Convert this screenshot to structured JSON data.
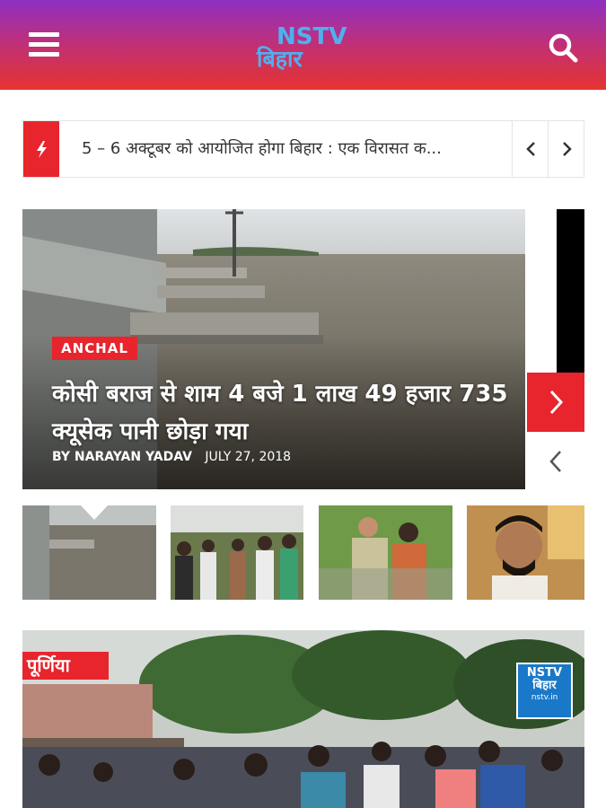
{
  "header": {
    "logo_line1": "NSTV",
    "logo_line2": "बिहार",
    "menu_icon": "hamburger-menu-icon",
    "search_icon": "search-icon",
    "gradient_colors": [
      "#8e2fc2",
      "#e6342f"
    ]
  },
  "ticker": {
    "icon": "lightning-bolt-icon",
    "text": "5 – 6 अक्टूबर को आयोजित होगा बिहार : एक विरासत क...",
    "prev_icon": "chevron-left-icon",
    "next_icon": "chevron-right-icon"
  },
  "featured": {
    "category": "ANCHAL",
    "headline": "कोसी बराज से शाम 4 बजे 1 लाख 49 हजार 735 क्यूसेक पानी छोड़ा गया",
    "author": "BY NARAYAN YADAV",
    "date": "JULY 27, 2018",
    "next_icon": "chevron-right-icon",
    "prev_icon": "chevron-left-icon"
  },
  "second_story": {
    "tag": "पूर्णिया",
    "watermark_line1": "NSTV",
    "watermark_line2": "बिहार",
    "watermark_line3": "nstv.in"
  },
  "colors": {
    "accent": "#e8242d",
    "logo_blue": "#4fb0f0"
  }
}
